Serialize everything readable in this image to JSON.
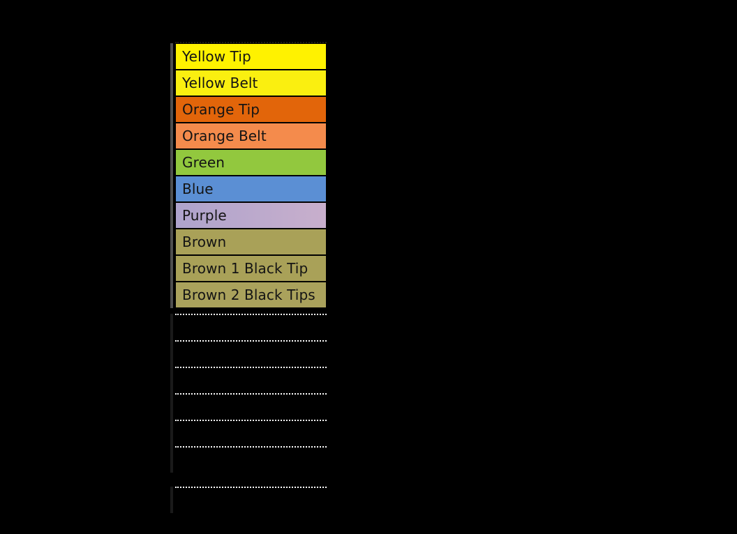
{
  "page": {
    "title": "Belt Rank List",
    "background_color": "#000000",
    "text_color": "#141414",
    "dotted_rule_color": "#ffffff",
    "row_handle_color": "#4f4f4f"
  },
  "belt_list": {
    "name": "belt-rank-list",
    "rows": [
      {
        "label": "Yellow Tip",
        "color": "#FFF200",
        "color_end": "#FFF200"
      },
      {
        "label": "Yellow Belt",
        "color": "#FAEF10",
        "color_end": "#FAEF10"
      },
      {
        "label": "Orange Tip",
        "color": "#E2650A",
        "color_end": "#E2650A"
      },
      {
        "label": "Orange Belt",
        "color": "#F48B4C",
        "color_end": "#F48B4C"
      },
      {
        "label": "Green",
        "color": "#92C83E",
        "color_end": "#92C83E"
      },
      {
        "label": "Blue",
        "color": "#5B8FD4",
        "color_end": "#5B8FD4"
      },
      {
        "label": "Purple",
        "color": "#AEA3CC",
        "color_end": "#C8AFCC"
      },
      {
        "label": "Brown",
        "color": "#A9A158",
        "color_end": "#A9A158"
      },
      {
        "label": "Brown 1 Black Tip",
        "color": "#A9A158",
        "color_end": "#A9A158"
      },
      {
        "label": "Brown 2 Black Tips",
        "color": "#AAA25C",
        "color_end": "#AAA25C"
      }
    ]
  },
  "empty_list": {
    "name": "empty-dotted-rows",
    "count": 7,
    "rows": [
      {
        "label": "",
        "gap_before": false
      },
      {
        "label": "",
        "gap_before": false
      },
      {
        "label": "",
        "gap_before": false
      },
      {
        "label": "",
        "gap_before": false
      },
      {
        "label": "",
        "gap_before": false
      },
      {
        "label": "",
        "gap_before": false
      },
      {
        "label": "",
        "gap_before": true
      }
    ]
  }
}
